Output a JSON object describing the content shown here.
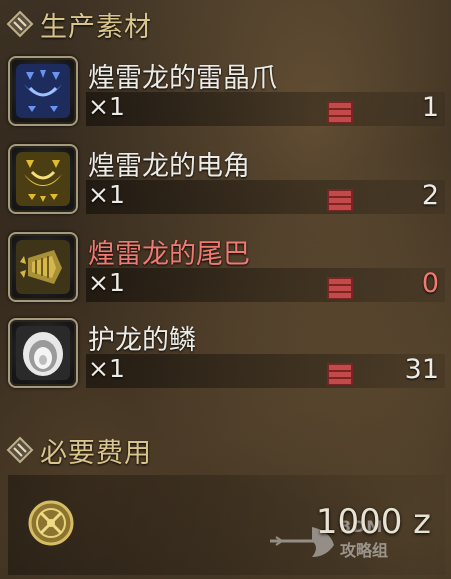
{
  "sections": {
    "materials_title": "生产素材",
    "fee_title": "必要费用"
  },
  "materials": [
    {
      "name": "煌雷龙的雷晶爪",
      "qty": "×1",
      "stock": "1",
      "icon": "blue-claw-icon",
      "insufficient": false
    },
    {
      "name": "煌雷龙的电角",
      "qty": "×1",
      "stock": "2",
      "icon": "yellow-horn-icon",
      "insufficient": false
    },
    {
      "name": "煌雷龙的尾巴",
      "qty": "×1",
      "stock": "0",
      "icon": "tail-icon",
      "insufficient": true
    },
    {
      "name": "护龙的鳞",
      "qty": "×1",
      "stock": "31",
      "icon": "white-scale-icon",
      "insufficient": false
    }
  ],
  "fee": {
    "amount": "1000 z",
    "icon": "zenny-coin-icon"
  },
  "watermark": {
    "line1": "3DM",
    "line2": "攻略组"
  },
  "colors": {
    "header_gold": "#d9c48c",
    "text_white": "#ecebe6",
    "insufficient_red": "#f07a72",
    "box_red": "#b03a3a"
  }
}
